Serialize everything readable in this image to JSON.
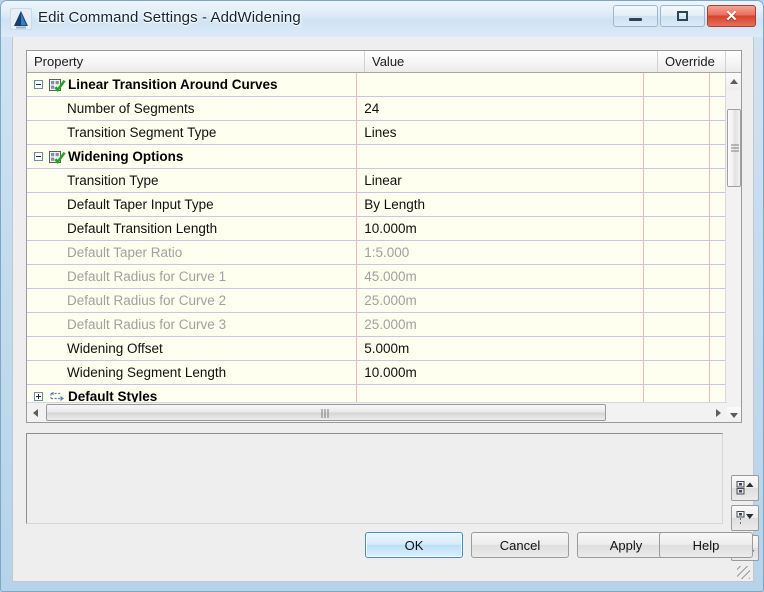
{
  "window": {
    "title": "Edit Command Settings - AddWidening",
    "app_icon": "autocad-logo-icon",
    "controls": {
      "minimize": "minimize-button",
      "maximize": "maximize-button",
      "close": "close-button"
    }
  },
  "grid": {
    "columns": [
      "Property",
      "Value",
      "Override",
      ""
    ],
    "rows": [
      {
        "type": "group",
        "expander": "minus",
        "icon": "settings-group-icon",
        "property": "Linear Transition Around Curves",
        "value": "",
        "override": "",
        "disabled": false
      },
      {
        "type": "item",
        "property": "Number of Segments",
        "value": "24",
        "override": "",
        "disabled": false
      },
      {
        "type": "item",
        "property": "Transition Segment Type",
        "value": "Lines",
        "override": "",
        "disabled": false
      },
      {
        "type": "group",
        "expander": "minus",
        "icon": "settings-group-icon",
        "property": "Widening Options",
        "value": "",
        "override": "",
        "disabled": false
      },
      {
        "type": "item",
        "property": "Transition Type",
        "value": "Linear",
        "override": "",
        "disabled": false
      },
      {
        "type": "item",
        "property": "Default Taper Input Type",
        "value": "By Length",
        "override": "",
        "disabled": false
      },
      {
        "type": "item",
        "property": "Default Transition Length",
        "value": "10.000m",
        "override": "",
        "disabled": false
      },
      {
        "type": "item",
        "property": "Default Taper Ratio",
        "value": "1:5.000",
        "override": "",
        "disabled": true
      },
      {
        "type": "item",
        "property": "Default Radius for Curve 1",
        "value": "45.000m",
        "override": "",
        "disabled": true
      },
      {
        "type": "item",
        "property": "Default Radius for Curve 2",
        "value": "25.000m",
        "override": "",
        "disabled": true
      },
      {
        "type": "item",
        "property": "Default Radius for Curve 3",
        "value": "25.000m",
        "override": "",
        "disabled": true
      },
      {
        "type": "item",
        "property": "Widening Offset",
        "value": "5.000m",
        "override": "",
        "disabled": false
      },
      {
        "type": "item",
        "property": "Widening Segment Length",
        "value": "10.000m",
        "override": "",
        "disabled": false
      },
      {
        "type": "group",
        "expander": "plus",
        "icon": "styles-group-icon",
        "property": "Default Styles",
        "value": "",
        "override": "",
        "disabled": false
      }
    ]
  },
  "side_tools": [
    {
      "name": "expand-all-button",
      "icon": "expand-all-icon"
    },
    {
      "name": "collapse-all-button",
      "icon": "collapse-all-icon"
    },
    {
      "name": "save-settings-button",
      "icon": "check-download-icon"
    }
  ],
  "buttons": {
    "ok": "OK",
    "cancel": "Cancel",
    "apply": "Apply",
    "help": "Help"
  },
  "colors": {
    "row_background": "#fffff0",
    "row_line": "#c9c4e8",
    "column_line": "#f0b9b9",
    "default_button_border": "#3c8fc7",
    "close_button": "#d9422c",
    "disabled_text": "#a0a0a0",
    "frame": "#b9d4ea"
  }
}
